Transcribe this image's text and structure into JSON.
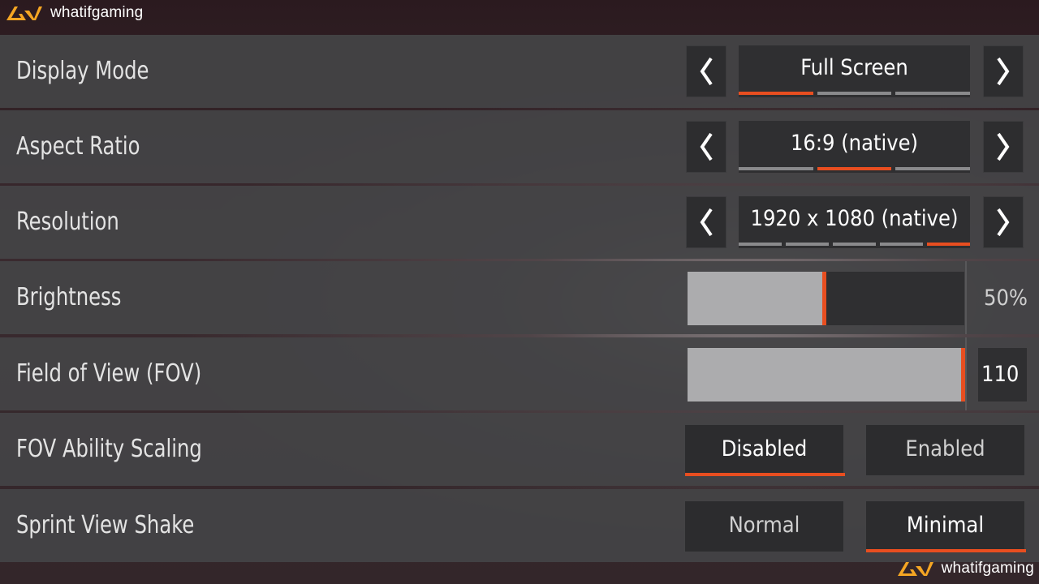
{
  "brand": {
    "text": "whatifgaming"
  },
  "colors": {
    "accent": "#e84e20",
    "panel": "#444446",
    "control": "#2f2f31",
    "text": "#ffffff"
  },
  "settings": {
    "display_mode": {
      "label": "Display Mode",
      "value": "Full Screen",
      "option_count": 3,
      "selected_index": 0
    },
    "aspect_ratio": {
      "label": "Aspect Ratio",
      "value": "16:9 (native)",
      "option_count": 3,
      "selected_index": 1
    },
    "resolution": {
      "label": "Resolution",
      "value": "1920 x 1080 (native)",
      "option_count": 5,
      "selected_index": 4
    },
    "brightness": {
      "label": "Brightness",
      "value": "50%",
      "fraction": 0.5
    },
    "fov": {
      "label": "Field of View (FOV)",
      "value": "110",
      "fraction": 1.0
    },
    "fov_ability_scaling": {
      "label": "FOV Ability Scaling",
      "options": [
        "Disabled",
        "Enabled"
      ],
      "selected": "Disabled"
    },
    "sprint_view_shake": {
      "label": "Sprint View Shake",
      "options": [
        "Normal",
        "Minimal"
      ],
      "selected": "Minimal"
    }
  },
  "icons": {
    "prev": "chevron-left-icon",
    "next": "chevron-right-icon",
    "logo": "whatifgaming-logo-icon"
  }
}
